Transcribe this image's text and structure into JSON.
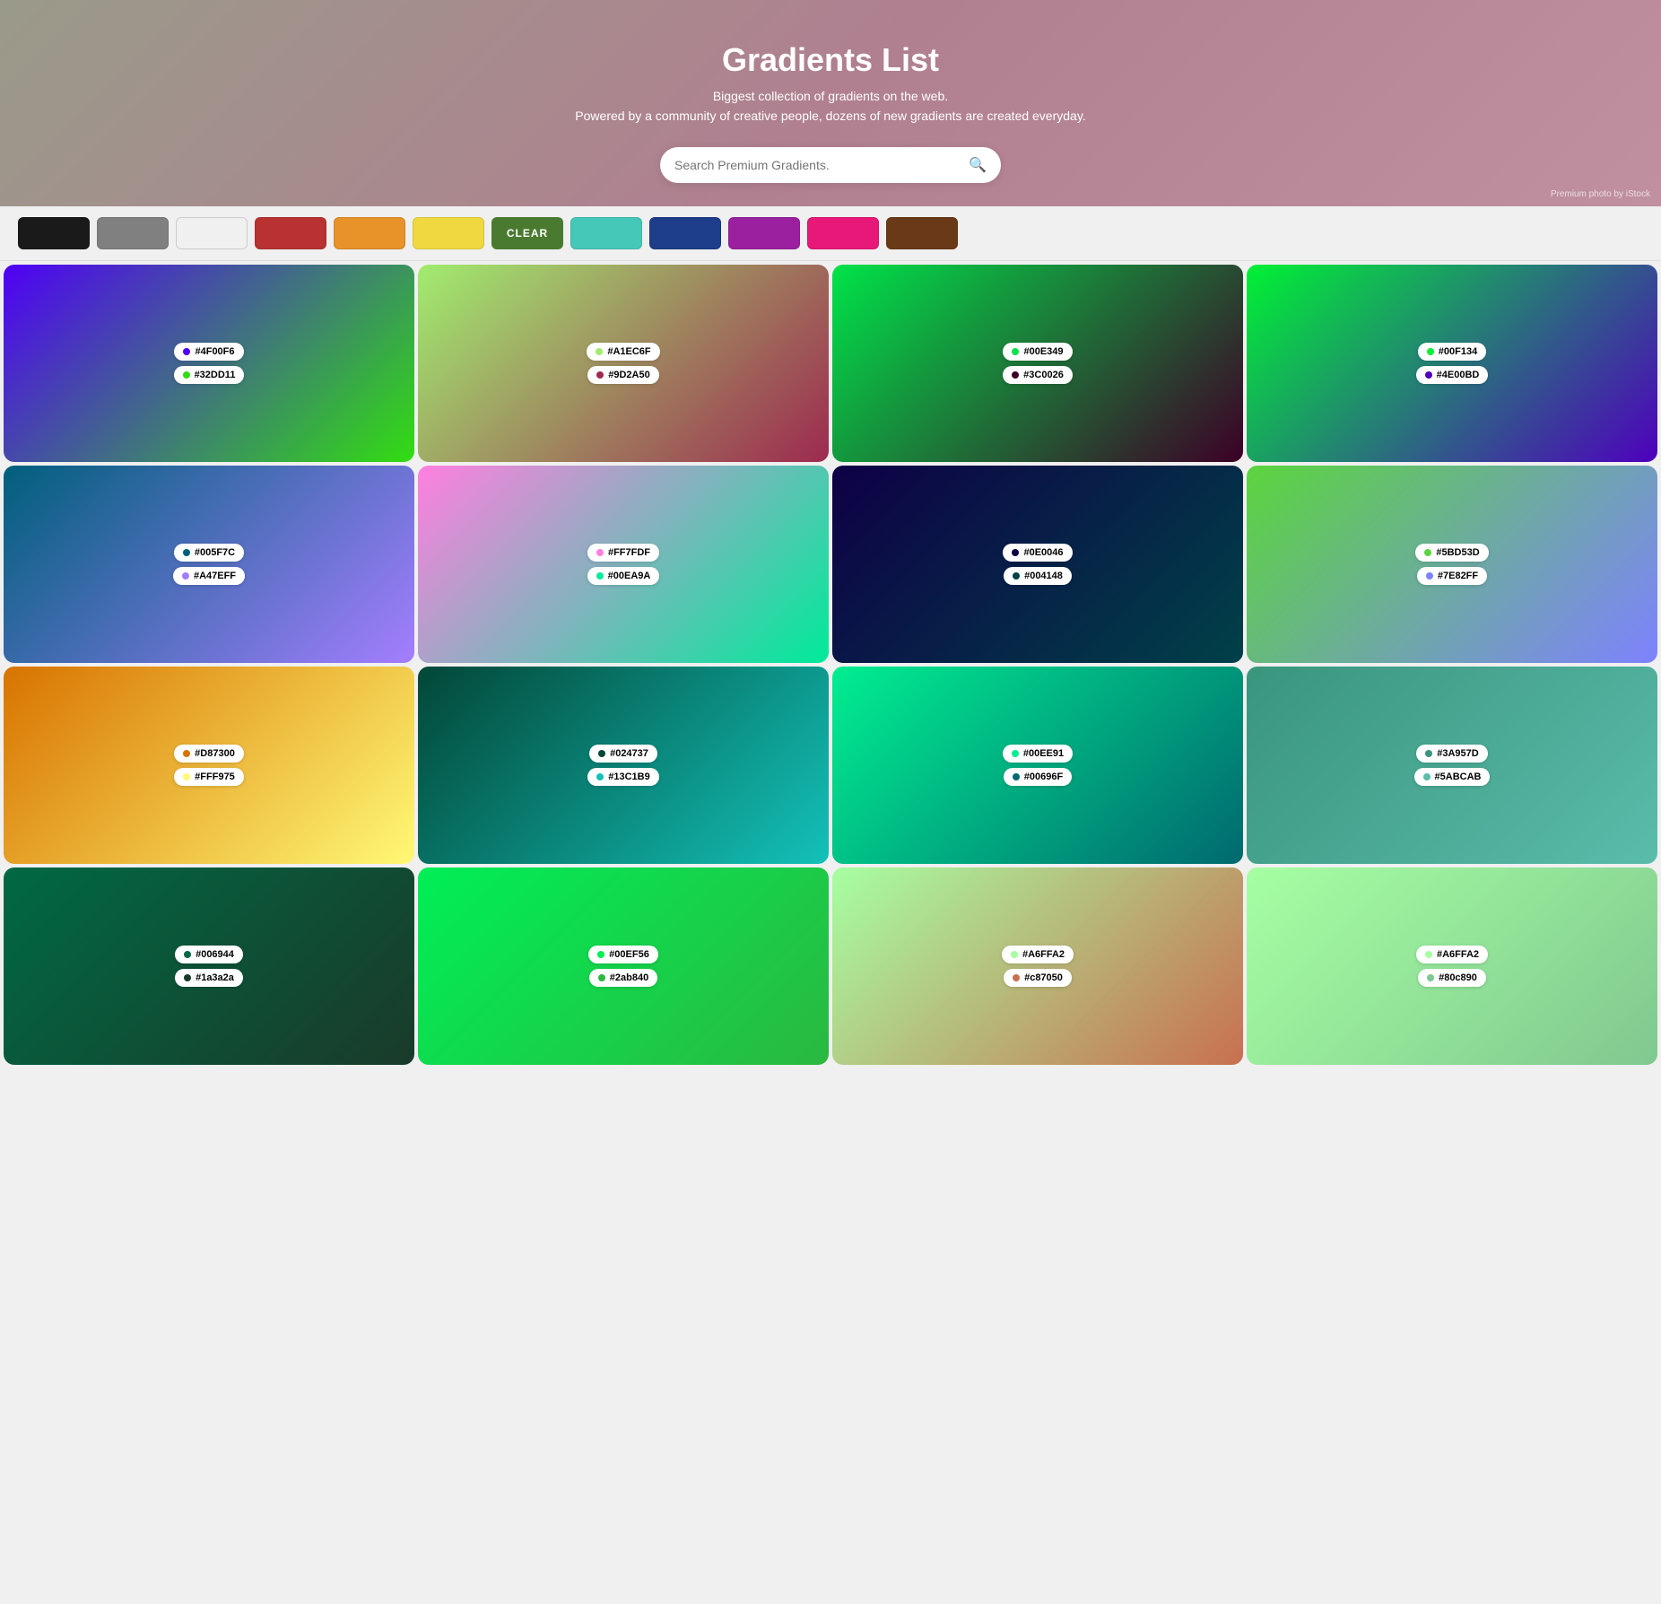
{
  "hero": {
    "title": "Gradients List",
    "subtitle_line1": "Biggest collection of gradients on the web.",
    "subtitle_line2": "Powered by a community of creative people, dozens of new gradients are created everyday.",
    "search_placeholder": "Search Premium Gradients.",
    "credit": "Premium photo by iStock"
  },
  "filters": {
    "swatches": [
      {
        "color": "#1a1a1a",
        "label": "black"
      },
      {
        "color": "#808080",
        "label": "gray"
      },
      {
        "color": "#f0f0f0",
        "label": "white"
      },
      {
        "color": "#b83232",
        "label": "red"
      },
      {
        "color": "#e8922a",
        "label": "orange"
      },
      {
        "color": "#f0d840",
        "label": "yellow"
      },
      {
        "color": "#4a7a30",
        "label": "green-dark",
        "is_clear": true
      },
      {
        "color": "#45c8b8",
        "label": "teal"
      },
      {
        "color": "#1e3d8a",
        "label": "blue"
      },
      {
        "color": "#9a20a0",
        "label": "purple"
      },
      {
        "color": "#e81878",
        "label": "pink"
      },
      {
        "color": "#6a3a18",
        "label": "brown"
      }
    ],
    "clear_label": "CLEAR"
  },
  "gradients": [
    {
      "color1": "#4F00F6",
      "color2": "#32DD11",
      "gradient": "linear-gradient(135deg, #4F00F6 0%, #32DD11 100%)"
    },
    {
      "color1": "#A1EC6F",
      "color2": "#9D2A50",
      "gradient": "linear-gradient(135deg, #A1EC6F 0%, #9D2A50 100%)"
    },
    {
      "color1": "#00E349",
      "color2": "#3C0026",
      "gradient": "linear-gradient(135deg, #00E349 0%, #3C0026 100%)"
    },
    {
      "color1": "#00F134",
      "color2": "#4E00BD",
      "gradient": "linear-gradient(135deg, #00F134 0%, #4E00BD 100%)"
    },
    {
      "color1": "#005F7C",
      "color2": "#A47EFF",
      "gradient": "linear-gradient(135deg, #005F7C 0%, #A47EFF 100%)"
    },
    {
      "color1": "#FF7FDF",
      "color2": "#00EA9A",
      "gradient": "linear-gradient(135deg, #FF7FDF 0%, #00EA9A 100%)"
    },
    {
      "color1": "#0E0046",
      "color2": "#004148",
      "gradient": "linear-gradient(135deg, #0E0046 0%, #004148 100%)"
    },
    {
      "color1": "#5BD53D",
      "color2": "#7E82FF",
      "gradient": "linear-gradient(135deg, #5BD53D 0%, #7E82FF 100%)"
    },
    {
      "color1": "#D87300",
      "color2": "#FFF975",
      "gradient": "linear-gradient(135deg, #D87300 0%, #FFF975 100%)"
    },
    {
      "color1": "#024737",
      "color2": "#13C1B9",
      "gradient": "linear-gradient(135deg, #024737 0%, #13C1B9 100%)"
    },
    {
      "color1": "#00EE91",
      "color2": "#00696F",
      "gradient": "linear-gradient(135deg, #00EE91 0%, #00696F 100%)"
    },
    {
      "color1": "#3A957D",
      "color2": "#5ABCAB",
      "gradient": "linear-gradient(135deg, #3A957D 0%, #5ABCAB 100%)"
    },
    {
      "color1": "#006944",
      "color2": "#1a3a2a",
      "gradient": "linear-gradient(135deg, #006944 0%, #1a3a2a 100%)"
    },
    {
      "color1": "#00EF56",
      "color2": "#2ab840",
      "gradient": "linear-gradient(135deg, #00EF56 0%, #2ab840 100%)"
    },
    {
      "color1": "#A6FFA2",
      "color2": "#c87050",
      "gradient": "linear-gradient(135deg, #A6FFA2 0%, #c87050 100%)"
    },
    {
      "color1": "#A6FFA2",
      "color2": "#80c890",
      "gradient": "linear-gradient(135deg, #A6FFA2 0%, #80c890 100%)"
    }
  ]
}
